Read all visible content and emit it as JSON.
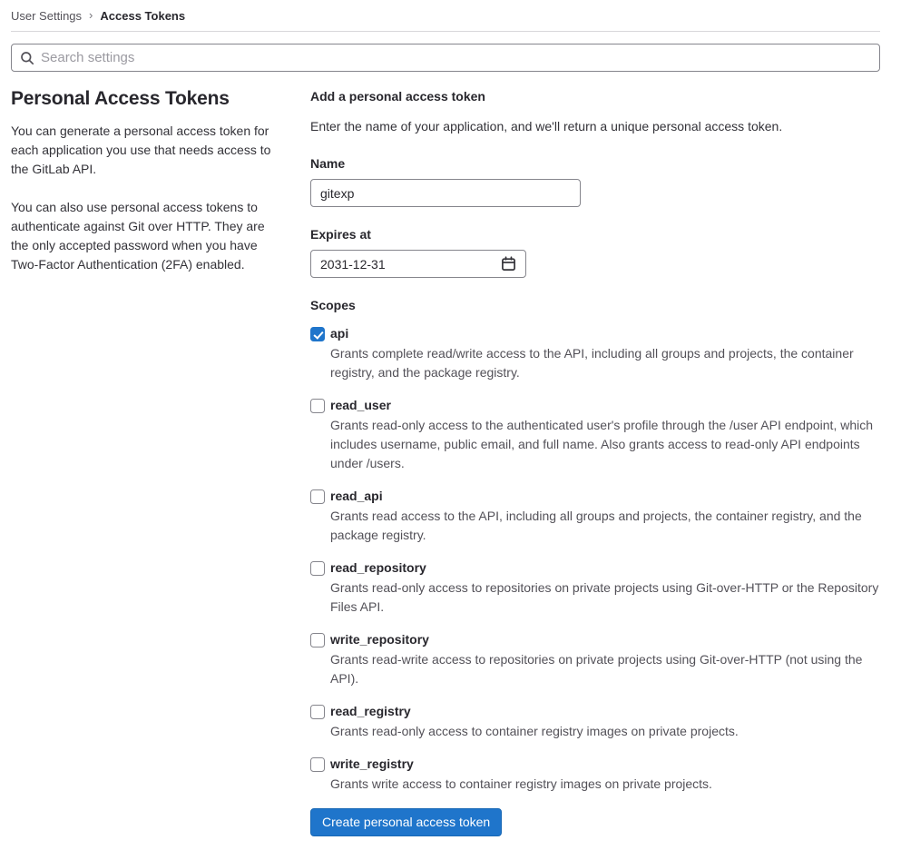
{
  "breadcrumb": {
    "parent": "User Settings",
    "separator": "›",
    "current": "Access Tokens"
  },
  "search": {
    "placeholder": "Search settings",
    "icon": "search-icon"
  },
  "sidebar": {
    "title": "Personal Access Tokens",
    "paragraph1": "You can generate a personal access token for each application you use that needs access to the GitLab API.",
    "paragraph2": "You can also use personal access tokens to authenticate against Git over HTTP. They are the only accepted password when you have Two-Factor Authentication (2FA) enabled."
  },
  "form": {
    "title": "Add a personal access token",
    "description": "Enter the name of your application, and we'll return a unique personal access token.",
    "name_label": "Name",
    "name_value": "gitexp",
    "expires_label": "Expires at",
    "expires_value": "2031-12-31",
    "expires_icon": "calendar-icon",
    "scopes_label": "Scopes",
    "scopes": [
      {
        "label": "api",
        "checked": true,
        "description": "Grants complete read/write access to the API, including all groups and projects, the container registry, and the package registry."
      },
      {
        "label": "read_user",
        "checked": false,
        "description": "Grants read-only access to the authenticated user's profile through the /user API endpoint, which includes username, public email, and full name. Also grants access to read-only API endpoints under /users."
      },
      {
        "label": "read_api",
        "checked": false,
        "description": "Grants read access to the API, including all groups and projects, the container registry, and the package registry."
      },
      {
        "label": "read_repository",
        "checked": false,
        "description": "Grants read-only access to repositories on private projects using Git-over-HTTP or the Repository Files API."
      },
      {
        "label": "write_repository",
        "checked": false,
        "description": "Grants read-write access to repositories on private projects using Git-over-HTTP (not using the API)."
      },
      {
        "label": "read_registry",
        "checked": false,
        "description": "Grants read-only access to container registry images on private projects."
      },
      {
        "label": "write_registry",
        "checked": false,
        "description": "Grants write access to container registry images on private projects."
      }
    ],
    "submit_label": "Create personal access token"
  },
  "colors": {
    "accent_blue": "#1f75cb",
    "heading_text": "#28272d",
    "body_text": "#333238",
    "secondary_text": "#535158",
    "input_border": "#85858c",
    "divider": "#d8d7da"
  }
}
